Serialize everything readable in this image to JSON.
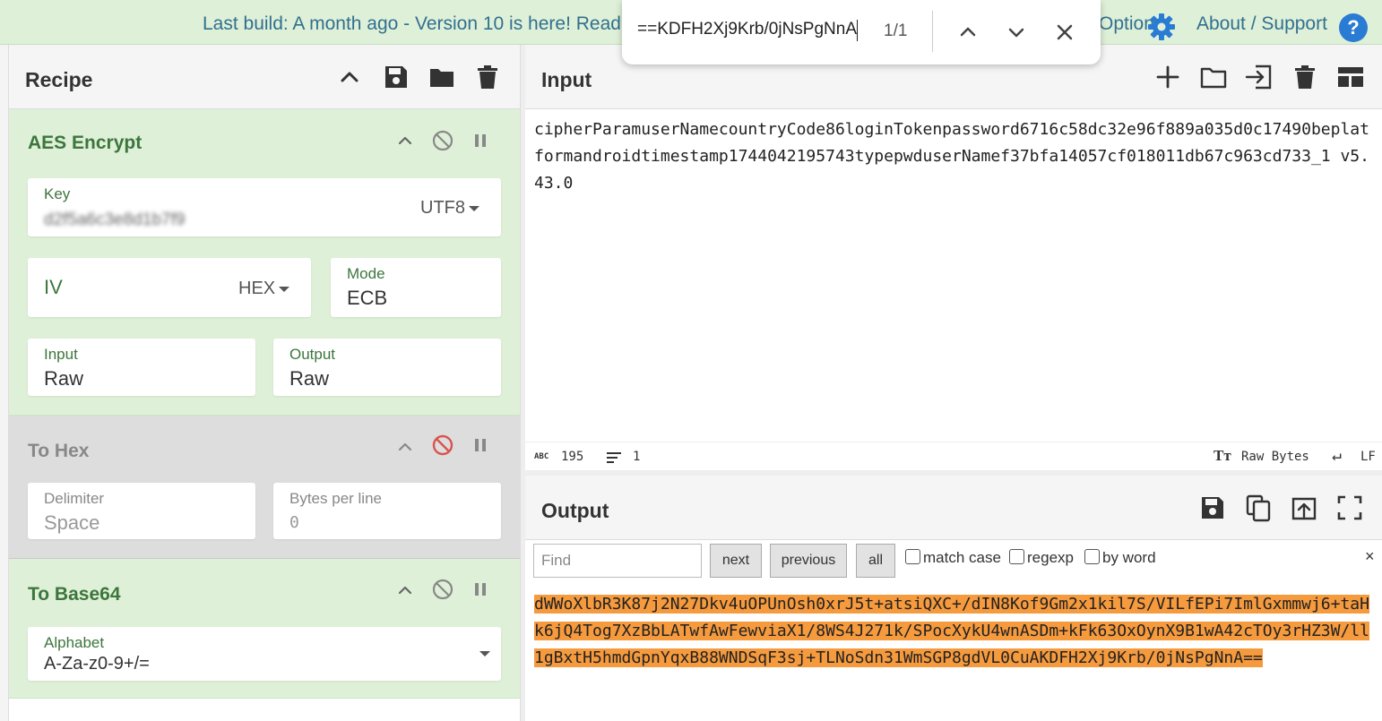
{
  "banner": {
    "message": "Last build: A month ago - Version 10 is here! Read",
    "options": "Options",
    "about": "About / Support",
    "help": "?"
  },
  "findbar": {
    "query": "KDFH2Xj9Krb/0jNsPgNnA==",
    "count": "1/1"
  },
  "recipe": {
    "title": "Recipe",
    "operations": [
      {
        "title": "AES Encrypt",
        "key_label": "Key",
        "key_value": "d2f5a6c3e8d1b7f9",
        "key_encoding": "UTF8",
        "iv_label": "IV",
        "iv_encoding": "HEX",
        "mode_label": "Mode",
        "mode_value": "ECB",
        "input_label": "Input",
        "input_value": "Raw",
        "output_label": "Output",
        "output_value": "Raw"
      },
      {
        "title": "To Hex",
        "delimiter_label": "Delimiter",
        "delimiter_value": "Space",
        "bpl_label": "Bytes per line",
        "bpl_value": "0"
      },
      {
        "title": "To Base64",
        "alphabet_label": "Alphabet",
        "alphabet_value": "A-Za-z0-9+/="
      }
    ]
  },
  "input": {
    "title": "Input",
    "text": "cipherParamuserNamecountryCode86loginTokenpassword6716c58dc32e96f889a035d0c17490beplatformandroidtimestamp1744042195743typepwduserNamef37bfa14057cf018011db67c963cd733_1 v5.43.0",
    "status": {
      "chars": "195",
      "lines": "1",
      "encoding": "Raw Bytes",
      "eol": "LF"
    }
  },
  "output": {
    "title": "Output",
    "search": {
      "placeholder": "Find",
      "next": "next",
      "previous": "previous",
      "all": "all",
      "match_case": "match case",
      "regexp": "regexp",
      "by_word": "by word",
      "close": "×"
    },
    "text": "dWWoXlbR3K87j2N27Dkv4uOPUnOsh0xrJ5t+atsiQXC+/dIN8Kof9Gm2x1kil7S/VILfEPi7ImlGxmmwj6+taHk6jQ4Tog7XzBbLATwfAwFewviaX1/8WS4J271k/SPocXykU4wnASDm+kFk63OxOynX9B1wA42cTOy3rHZ3W/ll1gBxtH5hmdGpnYqxB88WNDSqF3sj+TLNoSdn31WmSGP8gdVL0CuAKDFH2Xj9Krb/0jNsPgNnA=="
  },
  "colors": {
    "banner_bg": "#dff0d8",
    "operation_bg": "#dff0d8",
    "disabled_bg": "#dddddd",
    "highlight": "#f69a3e",
    "disable_icon_active": "#d9534f",
    "link": "#31708f"
  }
}
